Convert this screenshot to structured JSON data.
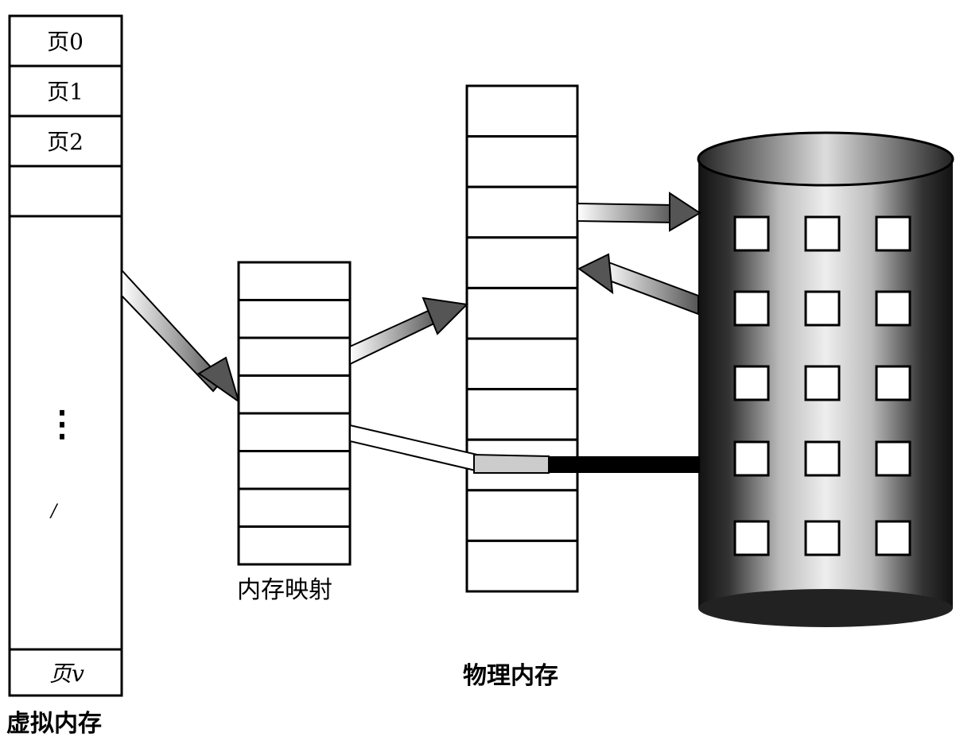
{
  "virtual_memory": {
    "caption": "虚拟内存",
    "pages": [
      "页0",
      "页1",
      "页2"
    ],
    "ellipsis": "⋮",
    "mark": "/",
    "last_page": "页v"
  },
  "memory_map": {
    "caption": "内存映射",
    "cell_count": 8
  },
  "physical_memory": {
    "caption": "物理内存",
    "cell_count": 10
  },
  "disk": {
    "window_rows": 5,
    "window_cols": 3
  }
}
